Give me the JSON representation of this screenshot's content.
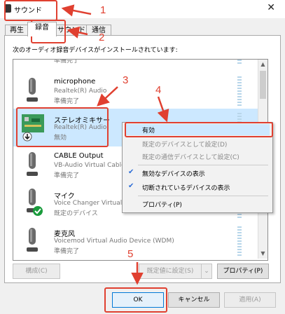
{
  "window": {
    "title": "サウンド",
    "close_glyph": "✕"
  },
  "tabs": [
    "再生",
    "録音",
    "サウンド",
    "通信"
  ],
  "active_tab": 1,
  "instruction": "次のオーディオ録音デバイスがインストールされています:",
  "devices": [
    {
      "name": "",
      "sub1": "",
      "sub2": "準備完了",
      "icon": "microphone-icon"
    },
    {
      "name": "microphone",
      "sub1": "Realtek(R) Audio",
      "sub2": "準備完了",
      "icon": "microphone-icon"
    },
    {
      "name": "ステレオミキサー",
      "sub1": "Realtek(R) Audio",
      "sub2": "無効",
      "icon": "circuit-board-icon"
    },
    {
      "name": "CABLE Output",
      "sub1": "VB-Audio Virtual Cable",
      "sub2": "準備完了",
      "icon": "microphone-icon"
    },
    {
      "name": "マイク",
      "sub1": "Voice Changer Virtual Audio Device (WDM)",
      "sub2": "既定のデバイス",
      "icon": "microphone-icon"
    },
    {
      "name": "麦克风",
      "sub1": "Voicemod Virtual Audio Device (WDM)",
      "sub2": "準備完了",
      "icon": "microphone-icon"
    }
  ],
  "context_menu": {
    "items": [
      {
        "label": "有効",
        "checked": false,
        "disabled": false
      },
      {
        "label": "既定のデバイスとして設定(D)",
        "checked": false,
        "disabled": true
      },
      {
        "label": "既定の通信デバイスとして設定(C)",
        "checked": false,
        "disabled": true
      },
      {
        "label": "無効なデバイスの表示",
        "checked": true,
        "disabled": false
      },
      {
        "label": "切断されているデバイスの表示",
        "checked": true,
        "disabled": false
      },
      {
        "label": "プロパティ(P)",
        "checked": false,
        "disabled": false
      }
    ]
  },
  "buttons": {
    "configure": "構成(C)",
    "set_default": "既定値に設定(S)",
    "properties": "プロパティ(P)",
    "ok": "OK",
    "cancel": "キャンセル",
    "apply": "適用(A)"
  },
  "annotations": [
    "1",
    "2",
    "3",
    "4",
    "5"
  ],
  "colors": {
    "annotation": "#e04030",
    "selection": "#cce8ff",
    "check": "#2b6cd6",
    "status_ok": "#1a9b3c"
  }
}
